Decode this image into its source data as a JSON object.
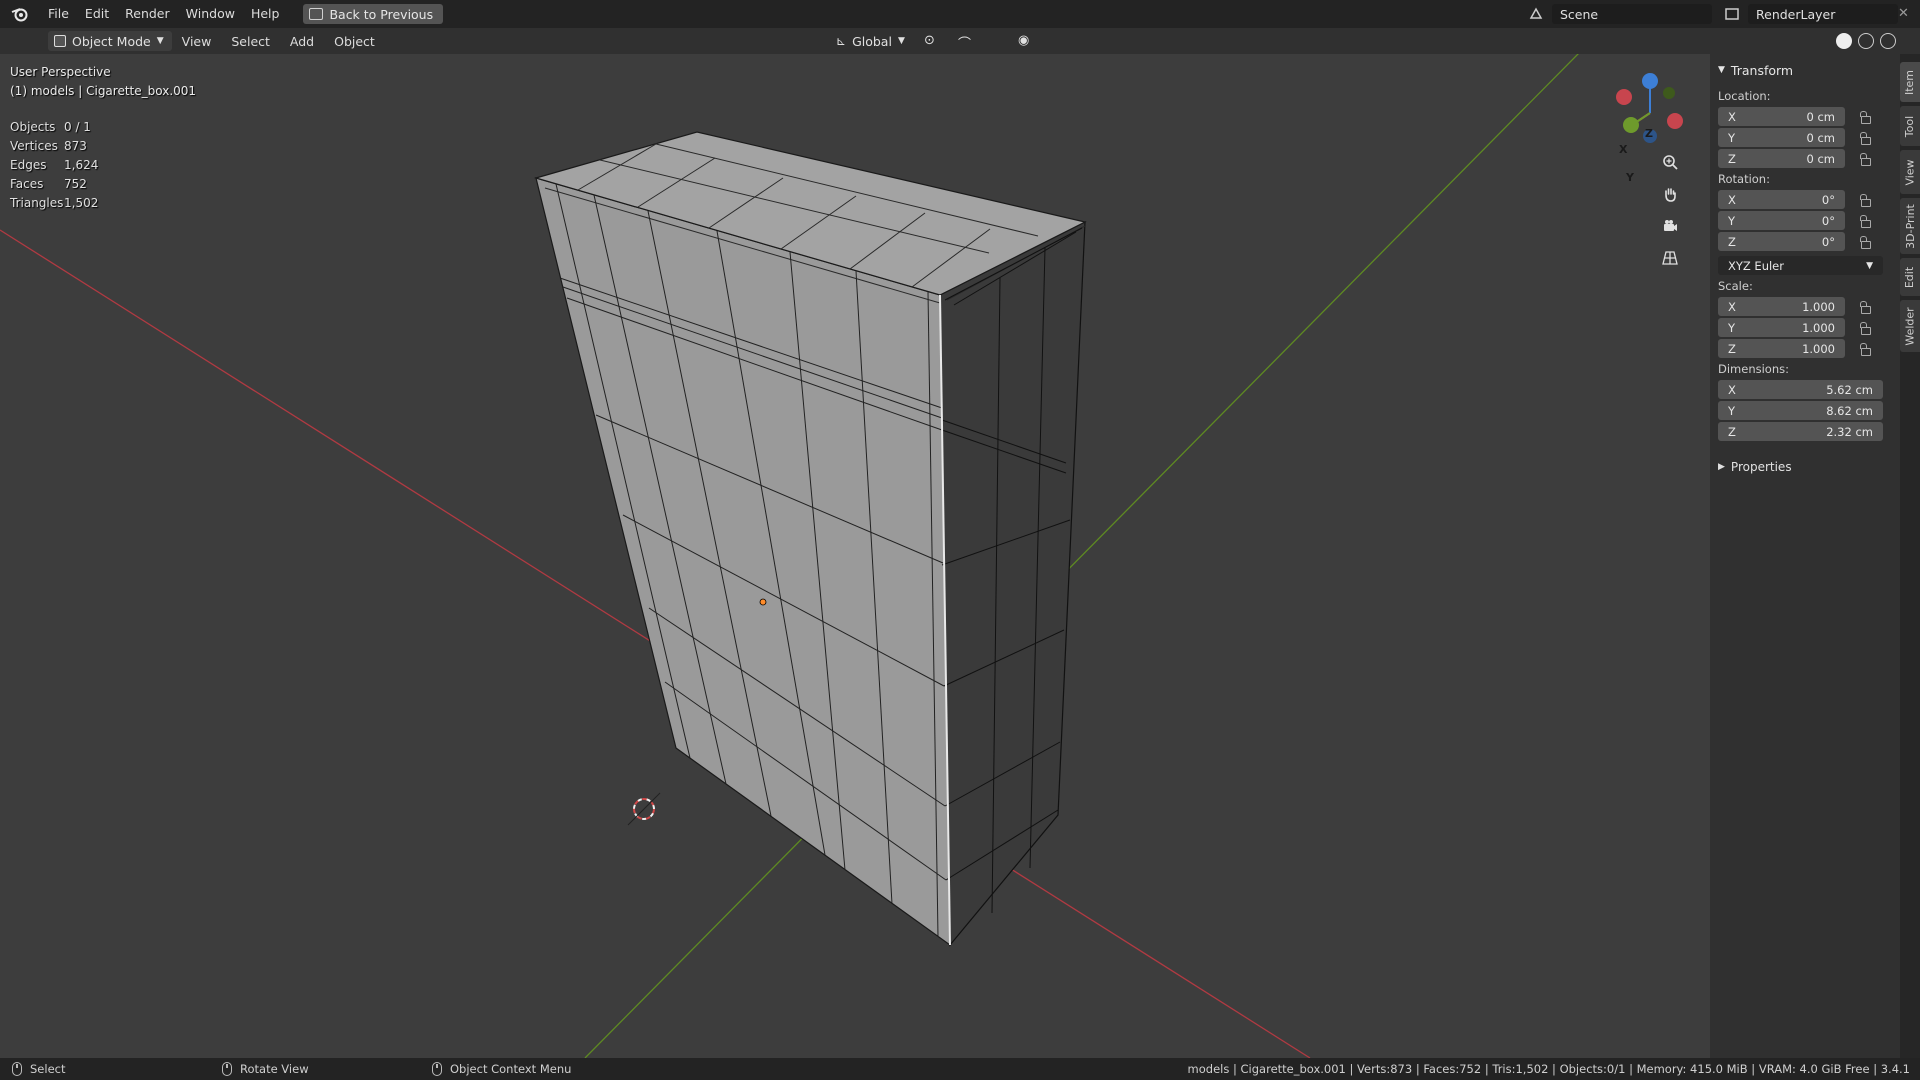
{
  "menubar": {
    "items": [
      "File",
      "Edit",
      "Render",
      "Window",
      "Help"
    ],
    "back_label": "Back to Previous",
    "scene": "Scene",
    "render_layer": "RenderLayer"
  },
  "view_header": {
    "mode": "Object Mode",
    "menus": [
      "View",
      "Select",
      "Add",
      "Object"
    ],
    "orientation": "Global"
  },
  "viewport": {
    "perspective": "User Perspective",
    "object_info": "(1) models | Cigarette_box.001",
    "stats": [
      {
        "label": "Objects",
        "value": "0 / 1"
      },
      {
        "label": "Vertices",
        "value": "873"
      },
      {
        "label": "Edges",
        "value": "1,624"
      },
      {
        "label": "Faces",
        "value": "752"
      },
      {
        "label": "Triangles",
        "value": "1,502"
      }
    ],
    "gizmo": {
      "x": "X",
      "y": "Y",
      "z": "Z"
    }
  },
  "npanel": {
    "transform_title": "Transform",
    "location_label": "Location:",
    "location": [
      {
        "axis": "X",
        "value": "0 cm"
      },
      {
        "axis": "Y",
        "value": "0 cm"
      },
      {
        "axis": "Z",
        "value": "0 cm"
      }
    ],
    "rotation_label": "Rotation:",
    "rotation": [
      {
        "axis": "X",
        "value": "0°"
      },
      {
        "axis": "Y",
        "value": "0°"
      },
      {
        "axis": "Z",
        "value": "0°"
      }
    ],
    "rotation_mode": "XYZ Euler",
    "scale_label": "Scale:",
    "scale": [
      {
        "axis": "X",
        "value": "1.000"
      },
      {
        "axis": "Y",
        "value": "1.000"
      },
      {
        "axis": "Z",
        "value": "1.000"
      }
    ],
    "dimensions_label": "Dimensions:",
    "dimensions": [
      {
        "axis": "X",
        "value": "5.62 cm"
      },
      {
        "axis": "Y",
        "value": "8.62 cm"
      },
      {
        "axis": "Z",
        "value": "2.32 cm"
      }
    ],
    "properties_title": "Properties"
  },
  "sidetabs": [
    "Item",
    "Tool",
    "View",
    "3D-Print",
    "Edit",
    "Welder"
  ],
  "statusbar": {
    "select": "Select",
    "rotate": "Rotate View",
    "context": "Object Context Menu",
    "info": "models | Cigarette_box.001 | Verts:873 | Faces:752 | Tris:1,502 | Objects:0/1 | Memory: 415.0 MiB | VRAM: 4.0 GiB Free | 3.4.1"
  },
  "colors": {
    "x_axis": "#c8454e",
    "y_axis": "#6e9a2c",
    "z_axis": "#3d7fd6",
    "origin": "#ff8c2a"
  }
}
